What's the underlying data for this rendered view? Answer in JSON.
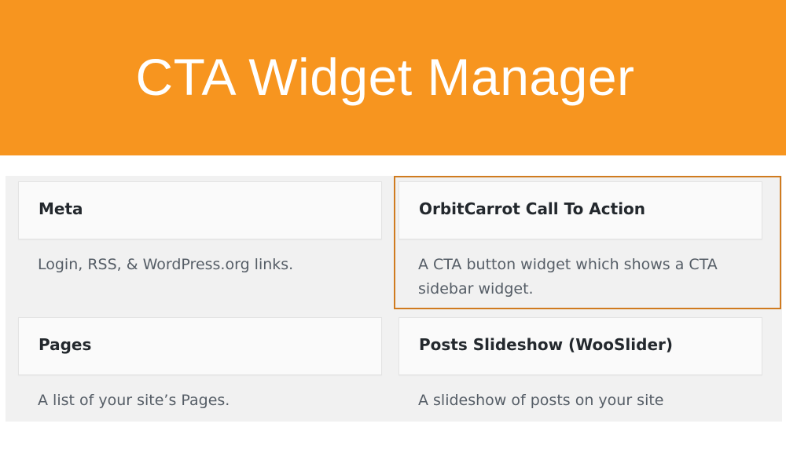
{
  "banner": {
    "title": "CTA Widget Manager",
    "background_color": "#f7951f"
  },
  "widgets": [
    {
      "title": "Meta",
      "description": "Login, RSS, & WordPress.org links."
    },
    {
      "title": "OrbitCarrot Call To Action",
      "description": "A CTA button widget which shows a CTA sidebar widget.",
      "highlighted": true
    },
    {
      "title": "Pages",
      "description": "A list of your site’s Pages."
    },
    {
      "title": "Posts Slideshow (WooSlider)",
      "description": "A slideshow of posts on your site"
    }
  ],
  "colors": {
    "highlight_border": "#d07b1f",
    "panel_background": "#f1f1f1"
  }
}
